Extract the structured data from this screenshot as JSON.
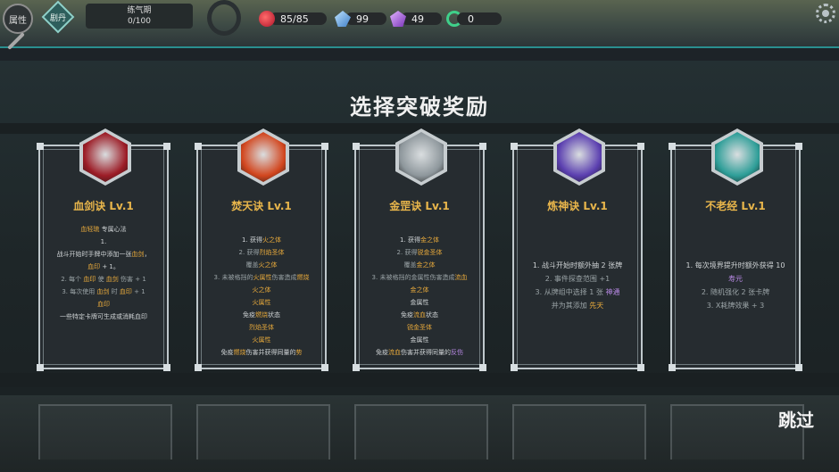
{
  "hud": {
    "attr_label": "属性",
    "diamond_label": "剧丹",
    "realm": {
      "name": "练气期",
      "progress": "0/100"
    },
    "stats": [
      {
        "icon": "hp-icon",
        "value": "85/85",
        "color": "#d9263f"
      },
      {
        "icon": "crystal-icon",
        "value": "99",
        "color": "#5aa8ee"
      },
      {
        "icon": "gem-icon",
        "value": "49",
        "color": "#9a55d0"
      },
      {
        "icon": "swirl-icon",
        "value": "0",
        "color": "#3fd08a"
      }
    ]
  },
  "title": "选择突破奖励",
  "skip_label": "跳过",
  "cards": [
    {
      "icon": "blood-sword-icon",
      "badge_color": "#9c1c26",
      "name": "血剑诀 Lv.1",
      "lines": [
        {
          "parts": [
            [
              "血轻琉",
              "hi"
            ],
            [
              " 专属心法",
              ""
            ]
          ]
        },
        {
          "parts": [
            [
              "1.",
              ""
            ]
          ]
        },
        {
          "parts": [
            [
              "战斗开始时手牌中添加一张",
              ""
            ],
            [
              "血剑",
              "hi"
            ],
            [
              "，",
              ""
            ]
          ]
        },
        {
          "parts": [
            [
              "血印",
              "hi"
            ],
            [
              " + 1。",
              ""
            ]
          ]
        },
        {
          "parts": [
            [
              "2. 每个 ",
              "gy"
            ],
            [
              "血印",
              "hi"
            ],
            [
              " 使 ",
              "gy"
            ],
            [
              "血剑",
              "hi"
            ],
            [
              " 伤害 + 1",
              "gy"
            ]
          ]
        },
        {
          "parts": [
            [
              "3. 每次使用 ",
              "gy"
            ],
            [
              "血剑",
              "hi"
            ],
            [
              " 时 ",
              "gy"
            ],
            [
              "血印",
              "hi"
            ],
            [
              " + 1",
              "gy"
            ]
          ]
        },
        {
          "parts": [
            [
              "血印",
              "hi"
            ]
          ]
        },
        {
          "parts": [
            [
              "一些特定卡牌可生成或消耗血印",
              ""
            ]
          ]
        }
      ]
    },
    {
      "icon": "fire-swirl-icon",
      "badge_color": "#d2461e",
      "name": "焚天诀 Lv.1",
      "lines": [
        {
          "parts": [
            [
              "1. 获得",
              ""
            ],
            [
              "火之体",
              "hi"
            ]
          ]
        },
        {
          "parts": [
            [
              "2. 获得",
              "gy"
            ],
            [
              "烈焰圣体",
              "hi"
            ]
          ]
        },
        {
          "parts": [
            [
              "覆盖",
              "gy"
            ],
            [
              "火之体",
              "hi"
            ]
          ]
        },
        {
          "parts": [
            [
              "3. 未被格挡的",
              "gy"
            ],
            [
              "火属性",
              "hi"
            ],
            [
              "伤害造成",
              "gy"
            ],
            [
              "燃烧",
              "hi"
            ]
          ]
        },
        {
          "parts": [
            [
              "火之体",
              "hi"
            ]
          ]
        },
        {
          "parts": [
            [
              "火属性",
              "hi"
            ]
          ]
        },
        {
          "parts": [
            [
              "免疫",
              ""
            ],
            [
              "燃烧",
              "hi"
            ],
            [
              "状态",
              ""
            ]
          ]
        },
        {
          "parts": [
            [
              "烈焰圣体",
              "hi"
            ]
          ]
        },
        {
          "parts": [
            [
              "火属性",
              "hi"
            ]
          ]
        },
        {
          "parts": [
            [
              "免疫",
              ""
            ],
            [
              "燃烧",
              "hi"
            ],
            [
              "伤害并获得同量的",
              ""
            ],
            [
              "势",
              "hi"
            ]
          ]
        }
      ]
    },
    {
      "icon": "metal-burst-icon",
      "badge_color": "#8e979c",
      "name": "金罡诀 Lv.1",
      "lines": [
        {
          "parts": [
            [
              "1. 获得",
              ""
            ],
            [
              "金之体",
              "hi"
            ]
          ]
        },
        {
          "parts": [
            [
              "2. 获得",
              "gy"
            ],
            [
              "锐金圣体",
              "hi"
            ]
          ]
        },
        {
          "parts": [
            [
              "覆盖",
              "gy"
            ],
            [
              "金之体",
              "hi"
            ]
          ]
        },
        {
          "parts": [
            [
              "3. 未被格挡的金属性伤害造成",
              "gy"
            ],
            [
              "流血",
              "hi"
            ]
          ]
        },
        {
          "parts": [
            [
              "金之体",
              "hi"
            ]
          ]
        },
        {
          "parts": [
            [
              "金属性",
              ""
            ]
          ]
        },
        {
          "parts": [
            [
              "免疫",
              ""
            ],
            [
              "流血",
              "hi"
            ],
            [
              "状态",
              ""
            ]
          ]
        },
        {
          "parts": [
            [
              "锐金圣体",
              "hi"
            ]
          ]
        },
        {
          "parts": [
            [
              "金属性",
              ""
            ]
          ]
        },
        {
          "parts": [
            [
              "免疫",
              ""
            ],
            [
              "流血",
              "hi"
            ],
            [
              "伤害并获得同量的",
              ""
            ],
            [
              "反伤",
              "pu"
            ]
          ]
        }
      ]
    },
    {
      "icon": "spirit-rune-icon",
      "badge_color": "#5b3fb0",
      "name": "炼神诀 Lv.1",
      "lines": [
        {
          "parts": [
            [
              "1. 战斗开始时额外抽 2 张牌",
              ""
            ]
          ]
        },
        {
          "parts": [
            [
              "2. 事件探查范围 +1",
              "gy"
            ]
          ]
        },
        {
          "parts": [
            [
              "3. 从牌组中选择 1 张 ",
              "gy"
            ],
            [
              "神通",
              "pu"
            ]
          ]
        },
        {
          "parts": [
            [
              "并为其添加 ",
              "gy"
            ],
            [
              "先天",
              "hi"
            ]
          ]
        }
      ]
    },
    {
      "icon": "meditation-icon",
      "badge_color": "#2e9e98",
      "name": "不老经 Lv.1",
      "lines": [
        {
          "parts": [
            [
              "1. 每次境界提升时额外获得 10",
              ""
            ]
          ]
        },
        {
          "parts": [
            [
              "寿元",
              "pu"
            ]
          ]
        },
        {
          "parts": [
            [
              "2. 随机强化 2 张卡牌",
              "gy"
            ]
          ]
        },
        {
          "parts": [
            [
              "3. X耗牌效果 + 3",
              "gy"
            ]
          ]
        }
      ]
    }
  ]
}
